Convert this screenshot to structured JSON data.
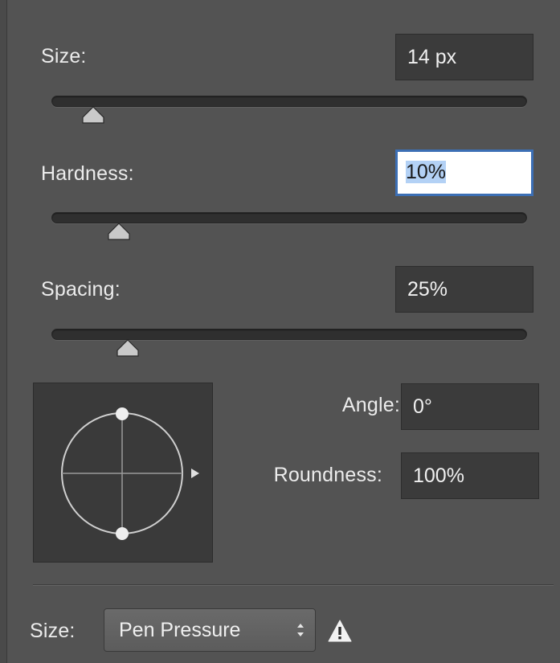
{
  "brush": {
    "size_label": "Size:",
    "size_value": "14 px",
    "size_level_pct": 4,
    "hardness_label": "Hardness:",
    "hardness_value": "10%",
    "hardness_level_pct": 10,
    "spacing_label": "Spacing:",
    "spacing_value": "25%",
    "spacing_level_pct": 12,
    "angle_label": "Angle:",
    "angle_value": "0°",
    "roundness_label": "Roundness:",
    "roundness_value": "100%"
  },
  "dynamics": {
    "size_label": "Size:",
    "size_control_selected": "Pen Pressure"
  },
  "icons": {
    "preview": "brush-tip-circle-icon",
    "warning": "warning-triangle-icon",
    "select_arrows": "up-down-chevron-icon"
  },
  "colors": {
    "panel_bg": "#535353",
    "field_bg": "#3b3b3b",
    "focus_ring": "#3c6fb5",
    "selection": "#b3d1f5"
  }
}
